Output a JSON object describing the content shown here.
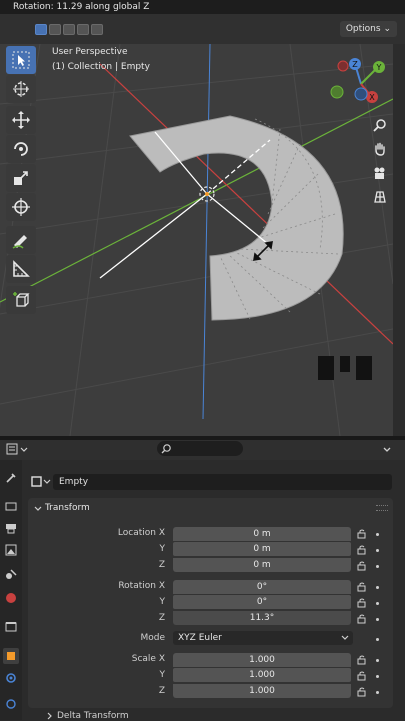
{
  "status": {
    "text": "Rotation: 11.29 along global Z"
  },
  "header": {
    "options_label": "Options"
  },
  "viewport": {
    "perspective": "User Perspective",
    "collection": "(1) Collection | Empty",
    "gizmo_axes": [
      "Z",
      "Y",
      "X"
    ]
  },
  "toolbar": {
    "tools": [
      "select-box",
      "cursor",
      "move",
      "rotate",
      "scale",
      "transform",
      "annotate",
      "measure",
      "add-cube"
    ],
    "active": "select-box"
  },
  "nav": [
    "zoom",
    "pan",
    "camera",
    "grid-view"
  ],
  "properties": {
    "object_name": "Empty",
    "panel_title": "Transform",
    "location": {
      "label_x": "Location X",
      "label_y": "Y",
      "label_z": "Z",
      "x": "0 m",
      "y": "0 m",
      "z": "0 m"
    },
    "rotation": {
      "label_x": "Rotation X",
      "label_y": "Y",
      "label_z": "Z",
      "x": "0°",
      "y": "0°",
      "z": "11.3°"
    },
    "mode": {
      "label": "Mode",
      "value": "XYZ Euler"
    },
    "scale": {
      "label_x": "Scale X",
      "label_y": "Y",
      "label_z": "Z",
      "x": "1.000",
      "y": "1.000",
      "z": "1.000"
    },
    "delta_title": "Delta Transform"
  },
  "colors": {
    "accent": "#4772b3",
    "x_axis": "#c8413f",
    "y_axis": "#6bb33a",
    "z_axis": "#4a84d6"
  }
}
